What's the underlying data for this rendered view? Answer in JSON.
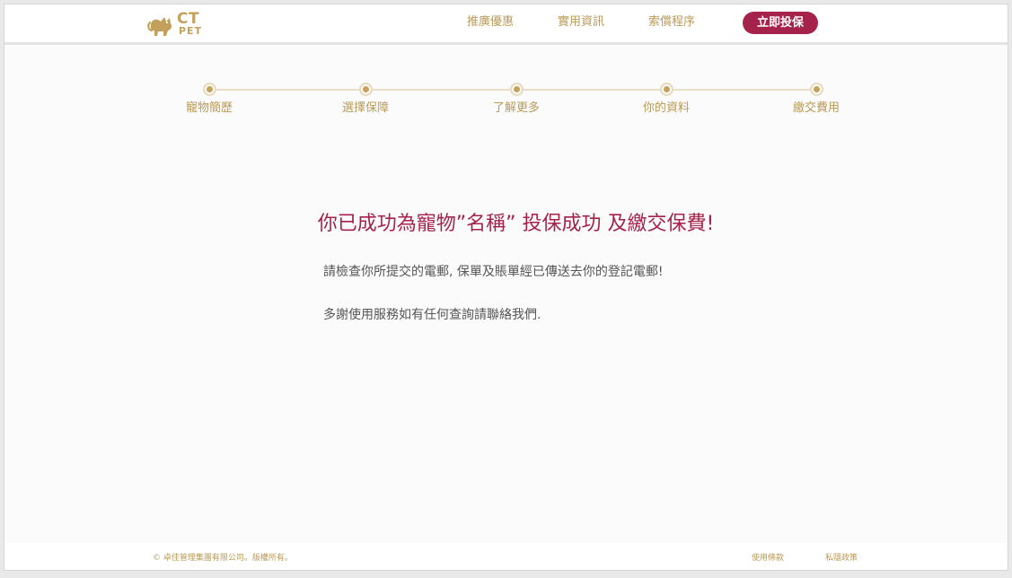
{
  "header": {
    "logo_ct": "CT",
    "logo_pet": "PET",
    "nav": [
      "推廣優惠",
      "實用資訊",
      "索償程序"
    ],
    "cta_label": "立即投保"
  },
  "stepper": {
    "steps": [
      "寵物簡歷",
      "選擇保障",
      "了解更多",
      "你的資料",
      "繳交費用"
    ]
  },
  "main": {
    "title": "你已成功為寵物”名稱” 投保成功 及繳交保費!",
    "messages": [
      "請檢查你所提交的電郵, 保單及賬單經已傳送去你的登記電郵!",
      "多謝使用服務如有任何查詢請聯絡我們."
    ]
  },
  "footer": {
    "copyright": "© 卓佳管理集團有限公司。版權所有。",
    "links": [
      "使用條款",
      "私隱政策"
    ]
  },
  "colors": {
    "brand_gold": "#c3a15c",
    "accent_crimson": "#a5234a"
  },
  "icons": {
    "logo": "cat-logo-icon",
    "step_marker": "step-dot-icon"
  }
}
